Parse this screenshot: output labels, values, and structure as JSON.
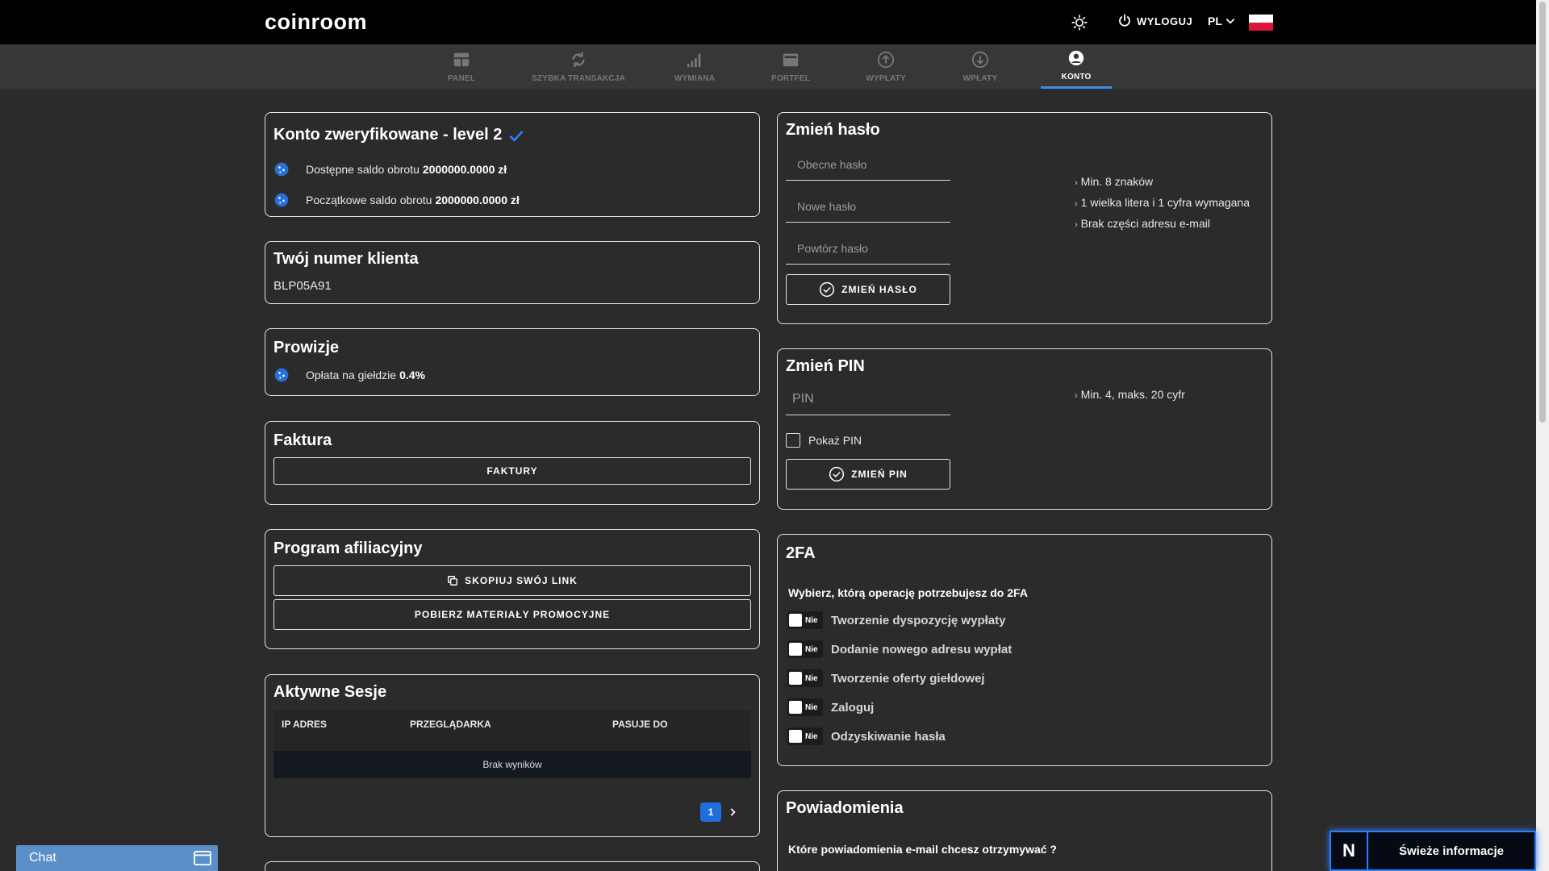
{
  "header": {
    "logo": "coinroom",
    "logout_label": "WYLOGUJ",
    "language": "PL"
  },
  "nav": [
    {
      "label": "PANEL",
      "icon": "dashboard-icon"
    },
    {
      "label": "SZYBKA TRANSAKCJA",
      "icon": "refresh-icon"
    },
    {
      "label": "WYMIANA",
      "icon": "signal-bars-icon"
    },
    {
      "label": "PORTFEL",
      "icon": "wallet-icon"
    },
    {
      "label": "WYPŁATY",
      "icon": "arrow-up-circle-icon"
    },
    {
      "label": "WPŁATY",
      "icon": "arrow-down-circle-icon"
    },
    {
      "label": "KONTO",
      "icon": "user-circle-icon",
      "active": true
    }
  ],
  "verified": {
    "title": "Konto zweryfikowane - level 2",
    "available_label": "Dostępne saldo obrotu",
    "available_value": "2000000.0000 zł",
    "initial_label": "Początkowe saldo obrotu",
    "initial_value": "2000000.0000 zł"
  },
  "client": {
    "title": "Twój numer klienta",
    "number": "BLP05A91"
  },
  "fees": {
    "title": "Prowizje",
    "label": "Opłata na giełdzie",
    "value": "0.4%"
  },
  "invoice": {
    "title": "Faktura",
    "button": "FAKTURY"
  },
  "affiliate": {
    "title": "Program afiliacyjny",
    "copy_button": "SKOPIUJ SWÓJ LINK",
    "download_button": "POBIERZ MATERIAŁY PROMOCYJNE"
  },
  "sessions": {
    "title": "Aktywne Sesje",
    "columns": [
      "IP ADRES",
      "PRZEGLĄDARKA",
      "PASUJE DO"
    ],
    "empty": "Brak wyników",
    "page": "1"
  },
  "password": {
    "title": "Zmień hasło",
    "current_placeholder": "Obecne hasło",
    "new_placeholder": "Nowe hasło",
    "repeat_placeholder": "Powtórz hasło",
    "button": "ZMIEŃ HASŁO",
    "hints": [
      "Min. 8 znaków",
      "1 wielka litera i 1 cyfra wymagana",
      "Brak części adresu e-mail"
    ]
  },
  "pin": {
    "title": "Zmień PIN",
    "placeholder": "PIN",
    "show_label": "Pokaż PIN",
    "button": "ZMIEŃ PIN",
    "hint": "Min. 4, maks. 20 cyfr"
  },
  "twofa": {
    "title": "2FA",
    "question": "Wybierz, którą operację potrzebujesz do 2FA",
    "toggle_label": "Nie",
    "options": [
      "Tworzenie dyspozycję wypłaty",
      "Dodanie nowego adresu wypłat",
      "Tworzenie oferty giełdowej",
      "Zaloguj",
      "Odzyskiwanie hasła"
    ]
  },
  "notifications": {
    "title": "Powiadomienia",
    "question": "Które powiadomienia e-mail chcesz otrzymywać ?"
  },
  "chat": {
    "label": "Chat"
  },
  "news": {
    "logo": "N",
    "label": "Świeże informacje"
  },
  "colors": {
    "accent": "#3a8ee6",
    "check": "#2a7fff",
    "page_active": "#1e6fd9"
  }
}
